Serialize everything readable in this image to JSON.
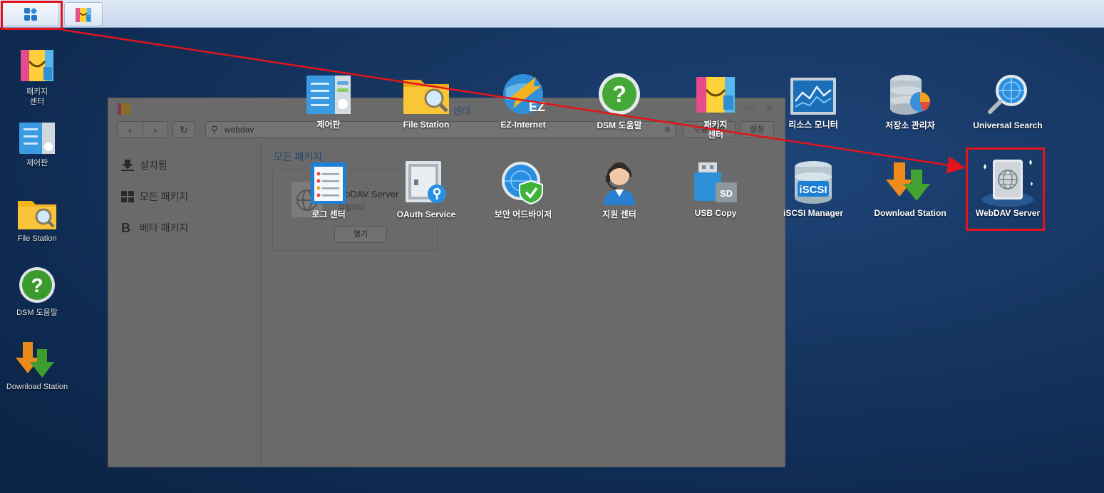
{
  "taskbar": {
    "main_menu_icon": "grid-icon",
    "package_center_icon": "shopping-bag-icon"
  },
  "desktop_shortcuts": [
    {
      "label": "패키지\n센터",
      "icon": "package-center-icon"
    },
    {
      "label": "제어판",
      "icon": "control-panel-icon"
    },
    {
      "label": "File Station",
      "icon": "folder-search-icon"
    },
    {
      "label": "DSM 도움말",
      "icon": "help-icon"
    },
    {
      "label": "Download Station",
      "icon": "download-arrows-icon"
    }
  ],
  "window": {
    "title_fragment": "센터",
    "search_value": "webdav",
    "manual_install_label": "수동 설치",
    "settings_label": "설정",
    "sidebar": [
      {
        "label": "설치됨",
        "icon": "download-icon"
      },
      {
        "label": "모든 패키지",
        "icon": "grid-icon"
      },
      {
        "label": "베타 패키지",
        "icon": "beta-icon"
      }
    ],
    "section_title": "모든 패키지",
    "package": {
      "name": "WebDAV Server",
      "category": "유틸리티",
      "open_label": "열기"
    }
  },
  "main_menu": {
    "apps": [
      {
        "label": "제어판",
        "icon": "control-panel-icon"
      },
      {
        "label": "File Station",
        "icon": "folder-search-icon"
      },
      {
        "label": "EZ-Internet",
        "icon": "ez-internet-icon"
      },
      {
        "label": "DSM 도움말",
        "icon": "help-icon"
      },
      {
        "label": "패키지\n센터",
        "icon": "package-center-icon"
      },
      {
        "label": "리소스 모니터",
        "icon": "resource-monitor-icon"
      },
      {
        "label": "저장소 관리자",
        "icon": "storage-manager-icon"
      },
      {
        "label": "Universal Search",
        "icon": "universal-search-icon"
      },
      {
        "label": "로그 센터",
        "icon": "log-center-icon"
      },
      {
        "label": "OAuth Service",
        "icon": "oauth-service-icon"
      },
      {
        "label": "보안 어드바이저",
        "icon": "security-advisor-icon"
      },
      {
        "label": "지원 센터",
        "icon": "support-center-icon"
      },
      {
        "label": "USB Copy",
        "icon": "usb-copy-icon"
      },
      {
        "label": "iSCSI Manager",
        "icon": "iscsi-manager-icon"
      },
      {
        "label": "Download Station",
        "icon": "download-station-icon"
      },
      {
        "label": "WebDAV Server",
        "icon": "webdav-server-icon"
      }
    ]
  },
  "colors": {
    "highlight": "#e3141b",
    "desktop_bg": "#173764",
    "taskbar_bg": "#d3e0f1"
  }
}
